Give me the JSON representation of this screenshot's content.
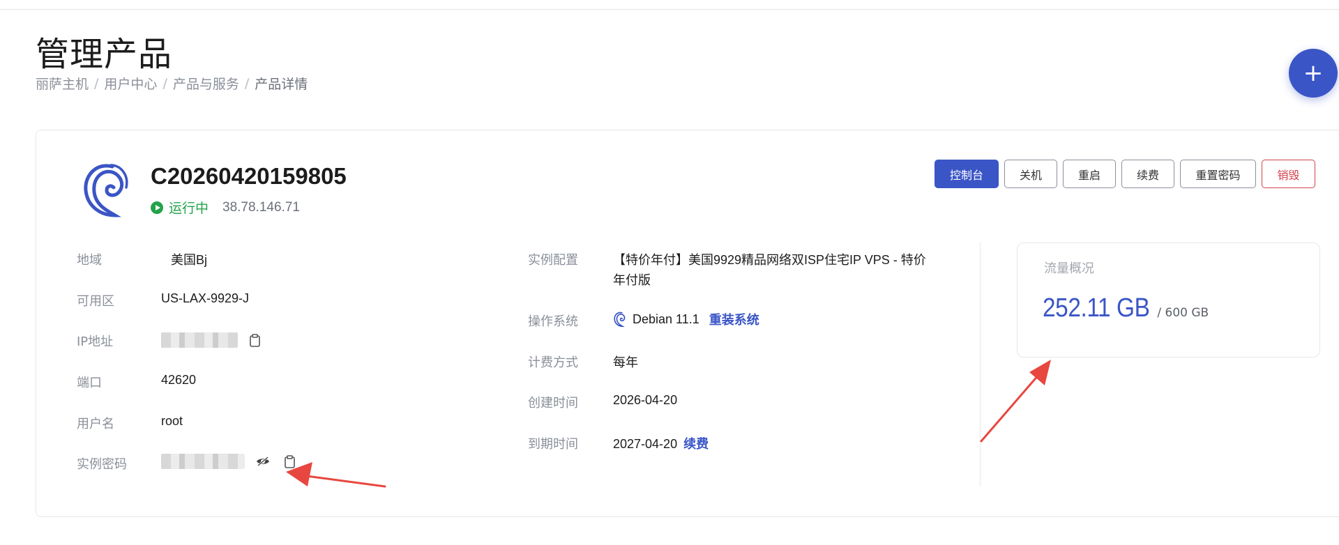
{
  "page": {
    "title": "管理产品",
    "breadcrumb": [
      "丽萨主机",
      "用户中心",
      "产品与服务",
      "产品详情"
    ]
  },
  "fab_label": "+",
  "product": {
    "id": "C20260420159805",
    "status": "运行中",
    "ip": "38.78.146.71"
  },
  "actions": {
    "console": "控制台",
    "shutdown": "关机",
    "restart": "重启",
    "renew": "续费",
    "reset_password": "重置密码",
    "destroy": "销毁"
  },
  "left_fields": {
    "region_label": "地域",
    "region_value": "美国Bj",
    "zone_label": "可用区",
    "zone_value": "US-LAX-9929-J",
    "ip_label": "IP地址",
    "port_label": "端口",
    "port_value": "42620",
    "username_label": "用户名",
    "username_value": "root",
    "password_label": "实例密码"
  },
  "right_fields": {
    "config_label": "实例配置",
    "config_value_line1": "【特价年付】美国9929精品网络双ISP住宅IP VPS - 特价",
    "config_value_line2": "年付版",
    "os_label": "操作系统",
    "os_value": "Debian 11.1",
    "os_reinstall": "重装系统",
    "billing_label": "计费方式",
    "billing_value": "每年",
    "created_label": "创建时间",
    "created_value": "2026-04-20",
    "expire_label": "到期时间",
    "expire_value": "2027-04-20",
    "expire_renew": "续费"
  },
  "traffic": {
    "title": "流量概况",
    "used": "252.11 GB",
    "total": " / 600 GB"
  },
  "colors": {
    "accent": "#3a55c6",
    "success": "#23a24a",
    "danger": "#d0424b",
    "annotation_arrow": "#e8473f"
  }
}
